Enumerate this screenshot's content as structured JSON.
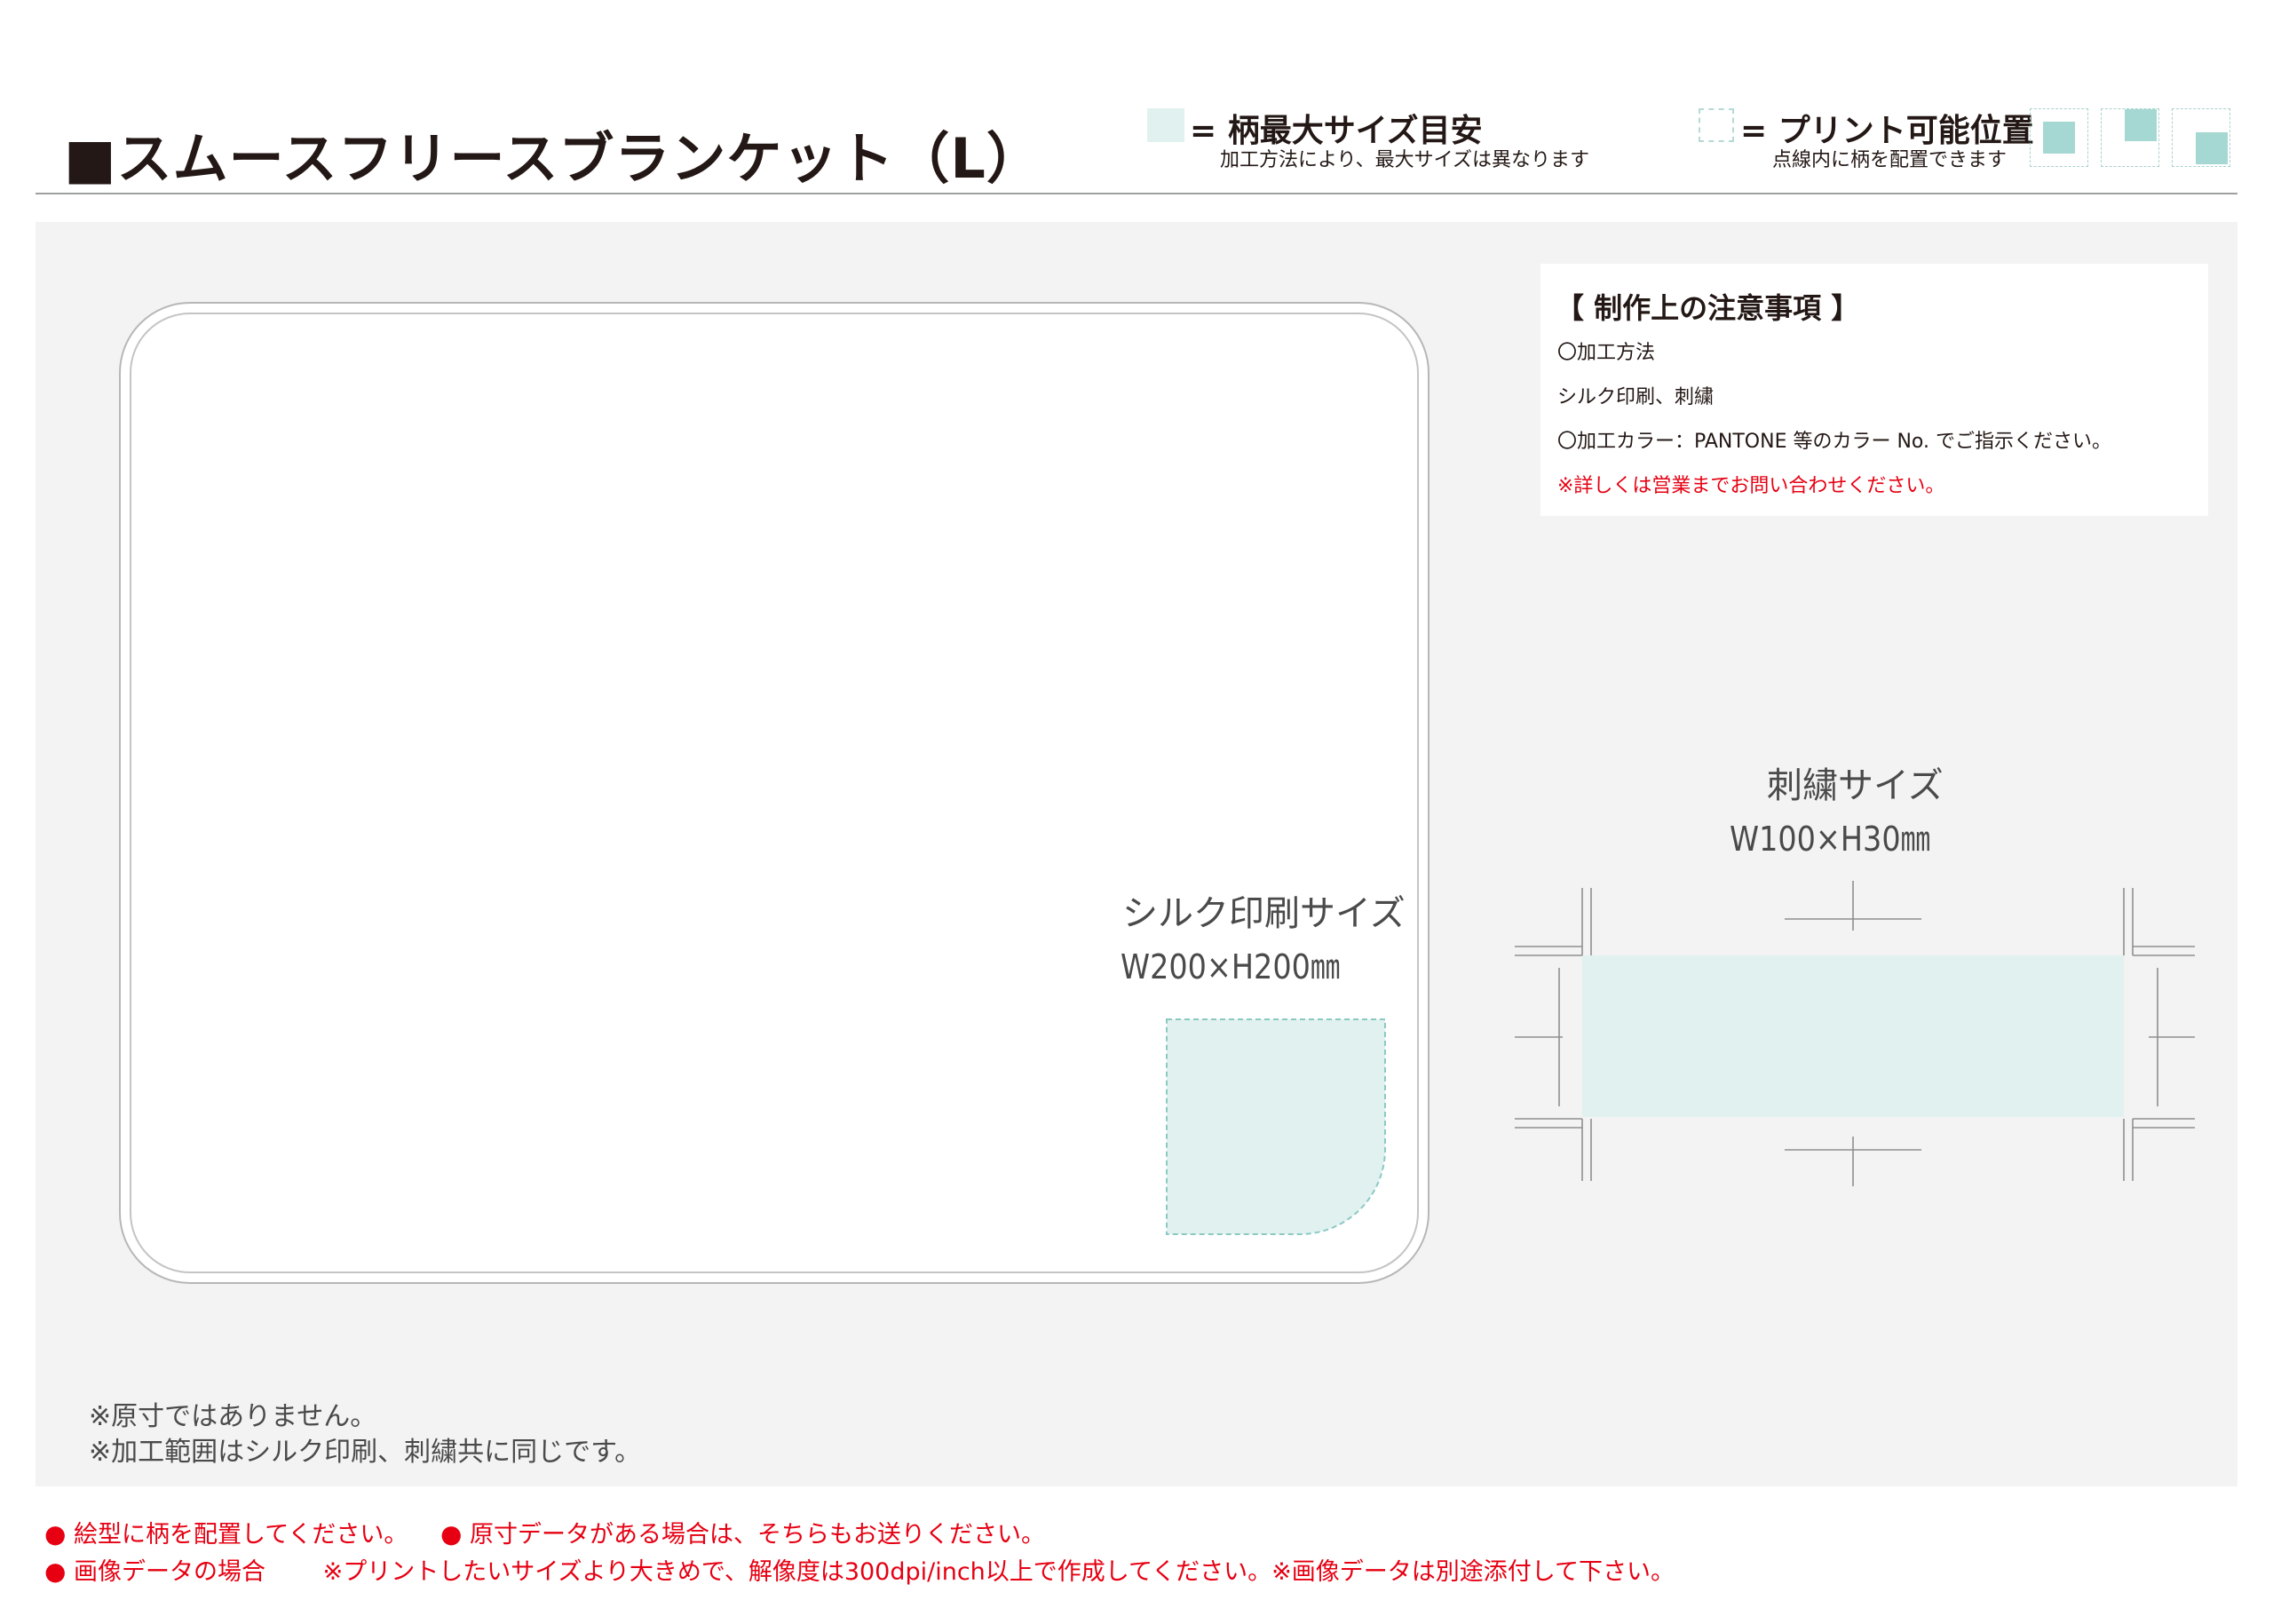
{
  "header": {
    "title": "■スムースフリースブランケット（L）",
    "legend_fill": {
      "title": "= 柄最大サイズ目安",
      "subtitle": "加工方法により、最大サイズは異なります",
      "color": "#e0f1f0"
    },
    "legend_dash": {
      "title": "= プリント可能位置",
      "subtitle": "点線内に柄を配置できます",
      "color": "#a6d8d3"
    },
    "position_icons": [
      "center-position-icon",
      "top-right-position-icon",
      "bottom-right-position-icon"
    ]
  },
  "template": {
    "silk": {
      "label": "シルク印刷サイズ",
      "size": "W200×H200㎜"
    },
    "embroidery": {
      "label": "刺繍サイズ",
      "size": "W100×H30㎜"
    }
  },
  "notice": {
    "title": "【  制作上の注意事項  】",
    "lines": [
      "〇加工方法",
      "シルク印刷、刺繍",
      "〇加工カラー：PANTONE 等のカラー No. でご指示ください。",
      "※詳しくは営業までお問い合わせください。"
    ]
  },
  "notes": [
    "※原寸ではありません。",
    "※加工範囲はシルク印刷、刺繍共に同じです。"
  ],
  "footer": {
    "bullet": "●",
    "item1": "絵型に柄を配置してください。",
    "item2": "原寸データがある場合は、そちらもお送りください。",
    "item3": "画像データの場合",
    "item3_detail": "※プリントしたいサイズより大きめで、解像度は300dpi/inch以上で作成してください。※画像データは別途添付して下さい。"
  },
  "colors": {
    "accent_red": "#e60012",
    "print_area": "#e0f1f0",
    "print_dash": "#8cc9c3"
  }
}
